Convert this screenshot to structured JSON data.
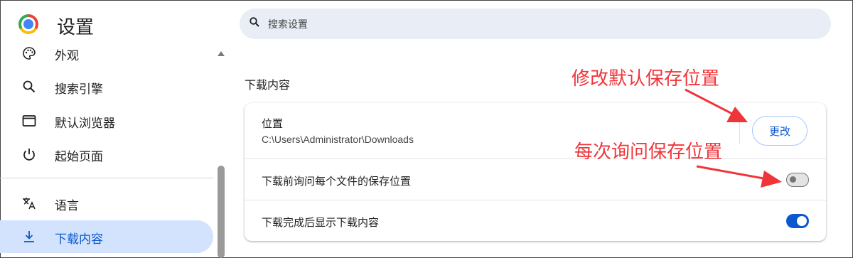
{
  "header": {
    "title": "设置",
    "search_placeholder": "搜索设置"
  },
  "sidebar": {
    "items": [
      {
        "label": "外观",
        "icon": "palette-icon"
      },
      {
        "label": "搜索引擎",
        "icon": "search-icon"
      },
      {
        "label": "默认浏览器",
        "icon": "browser-window-icon"
      },
      {
        "label": "起始页面",
        "icon": "power-icon"
      },
      {
        "label": "语言",
        "icon": "translate-icon"
      },
      {
        "label": "下载内容",
        "icon": "download-icon",
        "active": true
      }
    ]
  },
  "downloads": {
    "section_title": "下载内容",
    "location_label": "位置",
    "location_path": "C:\\Users\\Administrator\\Downloads",
    "change_button": "更改",
    "ask_label": "下载前询问每个文件的保存位置",
    "ask_enabled": false,
    "show_label": "下载完成后显示下载内容",
    "show_enabled": true
  },
  "annotations": {
    "top": "修改默认保存位置",
    "bottom": "每次询问保存位置",
    "color": "#f0353a"
  },
  "colors": {
    "accent": "#0b57d0",
    "active_bg": "#d3e3fd",
    "search_bg": "#e9eef6"
  }
}
